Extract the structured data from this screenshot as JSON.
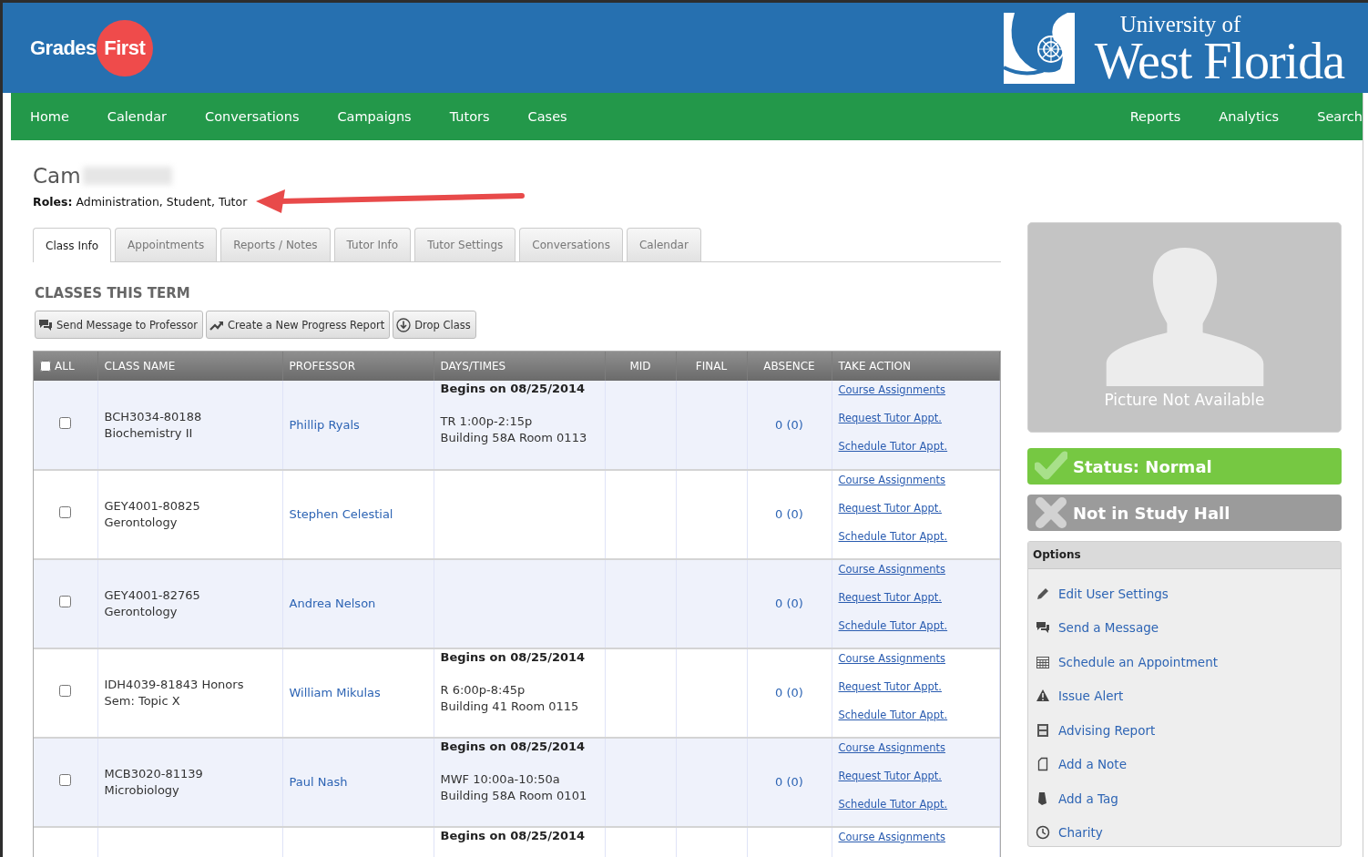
{
  "header": {
    "brand": "Grades",
    "brand_accent": "First",
    "university_line": "University of",
    "university_name": "West Florida"
  },
  "nav": {
    "left": [
      {
        "label": "Home"
      },
      {
        "label": "Calendar"
      },
      {
        "label": "Conversations"
      },
      {
        "label": "Campaigns"
      },
      {
        "label": "Tutors"
      },
      {
        "label": "Cases"
      }
    ],
    "right": [
      {
        "label": "Reports"
      },
      {
        "label": "Analytics"
      },
      {
        "label": "Search"
      }
    ]
  },
  "profile": {
    "name": "Cam",
    "roles_label": "Roles:",
    "roles": "Administration, Student, Tutor"
  },
  "tabs": [
    {
      "label": "Class Info",
      "selected": true
    },
    {
      "label": "Appointments",
      "selected": false
    },
    {
      "label": "Reports / Notes",
      "selected": false
    },
    {
      "label": "Tutor Info",
      "selected": false
    },
    {
      "label": "Tutor Settings",
      "selected": false
    },
    {
      "label": "Conversations",
      "selected": false
    },
    {
      "label": "Calendar",
      "selected": false
    }
  ],
  "section_title": "CLASSES THIS TERM",
  "toolbar": [
    {
      "kind": "chat",
      "label": "Send Message to Professor"
    },
    {
      "kind": "trend",
      "label": "Create a New Progress Report"
    },
    {
      "kind": "download",
      "label": "Drop Class"
    }
  ],
  "table": {
    "select_all_checked": false,
    "columns": [
      "ALL",
      "CLASS NAME",
      "PROFESSOR",
      "DAYS/TIMES",
      "MID",
      "FINAL",
      "ABSENCE",
      "TAKE ACTION"
    ],
    "rows": [
      {
        "checked": false,
        "class_name": "BCH3034-80188 Biochemistry II",
        "professor": "Phillip Ryals",
        "begins": "Begins on 08/25/2014",
        "schedule": "TR 1:00p-2:15p",
        "location": "Building 58A Room 0113",
        "absence": "0 (0)",
        "actions": [
          "Course Assignments",
          "Request Tutor Appt.",
          "Schedule Tutor Appt."
        ]
      },
      {
        "checked": false,
        "class_name": "GEY4001-80825 Gerontology",
        "professor": "Stephen Celestial",
        "absence": "0 (0)",
        "actions": [
          "Course Assignments",
          "Request Tutor Appt.",
          "Schedule Tutor Appt."
        ]
      },
      {
        "checked": false,
        "class_name": "GEY4001-82765 Gerontology",
        "professor": "Andrea Nelson",
        "absence": "0 (0)",
        "actions": [
          "Course Assignments",
          "Request Tutor Appt.",
          "Schedule Tutor Appt."
        ]
      },
      {
        "checked": false,
        "class_name": "IDH4039-81843 Honors Sem: Topic X",
        "professor": "William Mikulas",
        "begins": "Begins on 08/25/2014",
        "schedule": "R 6:00p-8:45p",
        "location": "Building 41 Room 0115",
        "absence": "0 (0)",
        "actions": [
          "Course Assignments",
          "Request Tutor Appt.",
          "Schedule Tutor Appt."
        ]
      },
      {
        "checked": false,
        "class_name": "MCB3020-81139 Microbiology",
        "professor": "Paul Nash",
        "begins": "Begins on 08/25/2014",
        "schedule": "MWF 10:00a-10:50a",
        "location": "Building 58A Room 0101",
        "absence": "0 (0)",
        "actions": [
          "Course Assignments",
          "Request Tutor Appt.",
          "Schedule Tutor Appt."
        ]
      },
      {
        "begins": "Begins on 08/25/2014",
        "actions": [
          "Course Assignments"
        ]
      }
    ]
  },
  "photo": {
    "caption": "Picture Not Available"
  },
  "status_cards": [
    {
      "kind": "ok",
      "label": "Status: Normal"
    },
    {
      "kind": "off",
      "label": "Not in Study Hall"
    }
  ],
  "options": {
    "title": "Options",
    "items": [
      {
        "kind": "pencil",
        "label": "Edit User Settings"
      },
      {
        "kind": "chat",
        "label": "Send a Message"
      },
      {
        "kind": "calendar",
        "label": "Schedule an Appointment"
      },
      {
        "kind": "alert",
        "label": "Issue Alert"
      },
      {
        "kind": "report",
        "label": "Advising Report"
      },
      {
        "kind": "note",
        "label": "Add a Note"
      },
      {
        "kind": "tag",
        "label": "Add a Tag"
      },
      {
        "kind": "clock",
        "label": "Charity"
      }
    ]
  }
}
